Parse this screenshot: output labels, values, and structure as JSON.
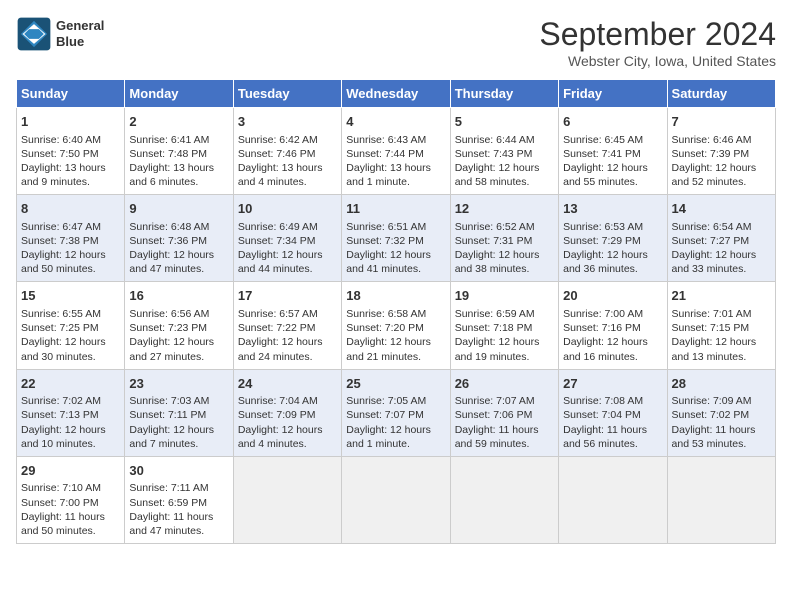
{
  "header": {
    "logo_line1": "General",
    "logo_line2": "Blue",
    "title": "September 2024",
    "subtitle": "Webster City, Iowa, United States"
  },
  "days_of_week": [
    "Sunday",
    "Monday",
    "Tuesday",
    "Wednesday",
    "Thursday",
    "Friday",
    "Saturday"
  ],
  "weeks": [
    [
      {
        "day": "1",
        "sunrise": "Sunrise: 6:40 AM",
        "sunset": "Sunset: 7:50 PM",
        "daylight": "Daylight: 13 hours and 9 minutes."
      },
      {
        "day": "2",
        "sunrise": "Sunrise: 6:41 AM",
        "sunset": "Sunset: 7:48 PM",
        "daylight": "Daylight: 13 hours and 6 minutes."
      },
      {
        "day": "3",
        "sunrise": "Sunrise: 6:42 AM",
        "sunset": "Sunset: 7:46 PM",
        "daylight": "Daylight: 13 hours and 4 minutes."
      },
      {
        "day": "4",
        "sunrise": "Sunrise: 6:43 AM",
        "sunset": "Sunset: 7:44 PM",
        "daylight": "Daylight: 13 hours and 1 minute."
      },
      {
        "day": "5",
        "sunrise": "Sunrise: 6:44 AM",
        "sunset": "Sunset: 7:43 PM",
        "daylight": "Daylight: 12 hours and 58 minutes."
      },
      {
        "day": "6",
        "sunrise": "Sunrise: 6:45 AM",
        "sunset": "Sunset: 7:41 PM",
        "daylight": "Daylight: 12 hours and 55 minutes."
      },
      {
        "day": "7",
        "sunrise": "Sunrise: 6:46 AM",
        "sunset": "Sunset: 7:39 PM",
        "daylight": "Daylight: 12 hours and 52 minutes."
      }
    ],
    [
      {
        "day": "8",
        "sunrise": "Sunrise: 6:47 AM",
        "sunset": "Sunset: 7:38 PM",
        "daylight": "Daylight: 12 hours and 50 minutes."
      },
      {
        "day": "9",
        "sunrise": "Sunrise: 6:48 AM",
        "sunset": "Sunset: 7:36 PM",
        "daylight": "Daylight: 12 hours and 47 minutes."
      },
      {
        "day": "10",
        "sunrise": "Sunrise: 6:49 AM",
        "sunset": "Sunset: 7:34 PM",
        "daylight": "Daylight: 12 hours and 44 minutes."
      },
      {
        "day": "11",
        "sunrise": "Sunrise: 6:51 AM",
        "sunset": "Sunset: 7:32 PM",
        "daylight": "Daylight: 12 hours and 41 minutes."
      },
      {
        "day": "12",
        "sunrise": "Sunrise: 6:52 AM",
        "sunset": "Sunset: 7:31 PM",
        "daylight": "Daylight: 12 hours and 38 minutes."
      },
      {
        "day": "13",
        "sunrise": "Sunrise: 6:53 AM",
        "sunset": "Sunset: 7:29 PM",
        "daylight": "Daylight: 12 hours and 36 minutes."
      },
      {
        "day": "14",
        "sunrise": "Sunrise: 6:54 AM",
        "sunset": "Sunset: 7:27 PM",
        "daylight": "Daylight: 12 hours and 33 minutes."
      }
    ],
    [
      {
        "day": "15",
        "sunrise": "Sunrise: 6:55 AM",
        "sunset": "Sunset: 7:25 PM",
        "daylight": "Daylight: 12 hours and 30 minutes."
      },
      {
        "day": "16",
        "sunrise": "Sunrise: 6:56 AM",
        "sunset": "Sunset: 7:23 PM",
        "daylight": "Daylight: 12 hours and 27 minutes."
      },
      {
        "day": "17",
        "sunrise": "Sunrise: 6:57 AM",
        "sunset": "Sunset: 7:22 PM",
        "daylight": "Daylight: 12 hours and 24 minutes."
      },
      {
        "day": "18",
        "sunrise": "Sunrise: 6:58 AM",
        "sunset": "Sunset: 7:20 PM",
        "daylight": "Daylight: 12 hours and 21 minutes."
      },
      {
        "day": "19",
        "sunrise": "Sunrise: 6:59 AM",
        "sunset": "Sunset: 7:18 PM",
        "daylight": "Daylight: 12 hours and 19 minutes."
      },
      {
        "day": "20",
        "sunrise": "Sunrise: 7:00 AM",
        "sunset": "Sunset: 7:16 PM",
        "daylight": "Daylight: 12 hours and 16 minutes."
      },
      {
        "day": "21",
        "sunrise": "Sunrise: 7:01 AM",
        "sunset": "Sunset: 7:15 PM",
        "daylight": "Daylight: 12 hours and 13 minutes."
      }
    ],
    [
      {
        "day": "22",
        "sunrise": "Sunrise: 7:02 AM",
        "sunset": "Sunset: 7:13 PM",
        "daylight": "Daylight: 12 hours and 10 minutes."
      },
      {
        "day": "23",
        "sunrise": "Sunrise: 7:03 AM",
        "sunset": "Sunset: 7:11 PM",
        "daylight": "Daylight: 12 hours and 7 minutes."
      },
      {
        "day": "24",
        "sunrise": "Sunrise: 7:04 AM",
        "sunset": "Sunset: 7:09 PM",
        "daylight": "Daylight: 12 hours and 4 minutes."
      },
      {
        "day": "25",
        "sunrise": "Sunrise: 7:05 AM",
        "sunset": "Sunset: 7:07 PM",
        "daylight": "Daylight: 12 hours and 1 minute."
      },
      {
        "day": "26",
        "sunrise": "Sunrise: 7:07 AM",
        "sunset": "Sunset: 7:06 PM",
        "daylight": "Daylight: 11 hours and 59 minutes."
      },
      {
        "day": "27",
        "sunrise": "Sunrise: 7:08 AM",
        "sunset": "Sunset: 7:04 PM",
        "daylight": "Daylight: 11 hours and 56 minutes."
      },
      {
        "day": "28",
        "sunrise": "Sunrise: 7:09 AM",
        "sunset": "Sunset: 7:02 PM",
        "daylight": "Daylight: 11 hours and 53 minutes."
      }
    ],
    [
      {
        "day": "29",
        "sunrise": "Sunrise: 7:10 AM",
        "sunset": "Sunset: 7:00 PM",
        "daylight": "Daylight: 11 hours and 50 minutes."
      },
      {
        "day": "30",
        "sunrise": "Sunrise: 7:11 AM",
        "sunset": "Sunset: 6:59 PM",
        "daylight": "Daylight: 11 hours and 47 minutes."
      },
      null,
      null,
      null,
      null,
      null
    ]
  ]
}
